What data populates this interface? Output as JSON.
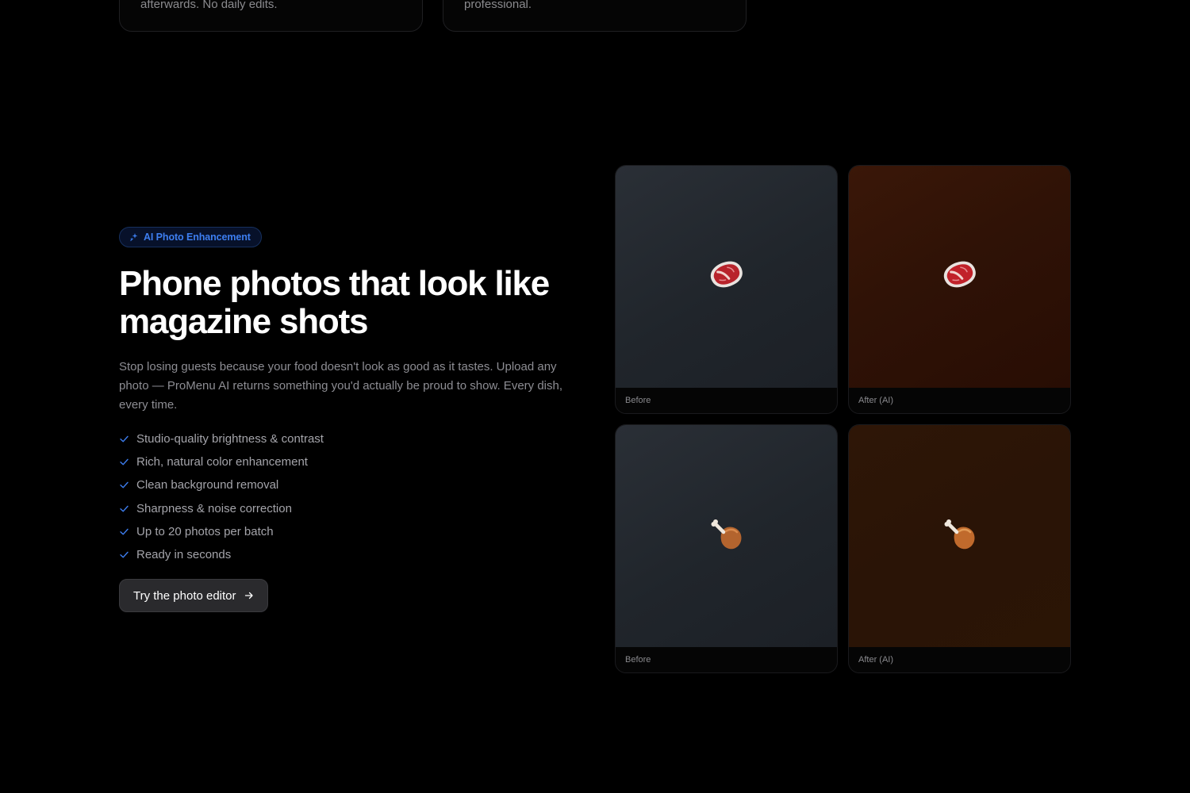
{
  "top_cards": [
    {
      "text": "afterwards. No daily edits."
    },
    {
      "text": "professional."
    }
  ],
  "badge": {
    "label": "AI Photo Enhancement",
    "icon": "sparkles-icon",
    "color": "#3d7ef0"
  },
  "hero": {
    "title_line1": "Phone photos that look like",
    "title_line2": "magazine shots",
    "description": "Stop losing guests because your food doesn't look as good as it tastes. Upload any photo — ProMenu AI returns something you'd actually be proud to show. Every dish, every time."
  },
  "features": [
    "Studio-quality brightness & contrast",
    "Rich, natural color enhancement",
    "Clean background removal",
    "Sharpness & noise correction",
    "Up to 20 photos per batch",
    "Ready in seconds"
  ],
  "cta": {
    "label": "Try the photo editor",
    "icon": "arrow-right-icon"
  },
  "gallery": [
    {
      "caption": "Before",
      "food": "steak-icon"
    },
    {
      "caption": "After (AI)",
      "food": "steak-icon"
    },
    {
      "caption": "Before",
      "food": "drumstick-icon"
    },
    {
      "caption": "After (AI)",
      "food": "drumstick-icon"
    }
  ],
  "colors": {
    "background": "#000000",
    "accent": "#3d7ef0",
    "check": "#3d7ef0"
  }
}
